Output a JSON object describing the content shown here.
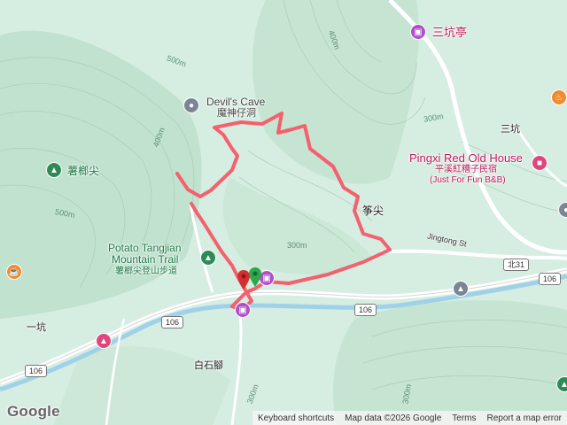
{
  "map": {
    "pois": {
      "sankeng_pavilion": "三坑亭",
      "devils_cave_en": "Devil's Cave",
      "devils_cave_zh": "魔神仔洞",
      "pingxi_en": "Pingxi Red Old House",
      "pingxi_zh": "平溪紅糟子民宿",
      "pingxi_sub": "(Just For Fun B&B)",
      "potato_mountain": "薯榔尖",
      "potato_trail_en_1": "Potato Tangjian",
      "potato_trail_en_2": "Mountain Trail",
      "potato_trail_zh": "薯榔尖登山步道",
      "zhengjian": "筝尖"
    },
    "places": {
      "sankeng": "三坑",
      "yikeng": "一坑",
      "baishijiao": "白石腳"
    },
    "roads": {
      "jingtong": "Jingtong St",
      "r106a": "106",
      "r106b": "106",
      "r106c": "106",
      "bei31": "北31"
    },
    "contours": [
      "400m",
      "500m",
      "400m",
      "300m",
      "500m",
      "300m",
      "300m",
      "300m"
    ],
    "icons": [
      "attraction-icon",
      "landmark-icon",
      "hotel-icon",
      "park-icon",
      "trail-icon",
      "restaurant-icon",
      "cafe-icon",
      "temple-icon",
      "school-icon",
      "start-marker-icon",
      "end-marker-icon"
    ],
    "colors": {
      "track": "#f4606e",
      "road": "#ffffff",
      "terrain": "#d9eee4",
      "forest": "#b9ddc8",
      "river": "#9fd2e8",
      "poi_pink": "#c2185b",
      "park_green": "#1e7a47"
    }
  },
  "logo": "Google",
  "footer": {
    "shortcuts": "Keyboard shortcuts",
    "data": "Map data ©2026 Google",
    "terms": "Terms",
    "report": "Report a map error"
  }
}
